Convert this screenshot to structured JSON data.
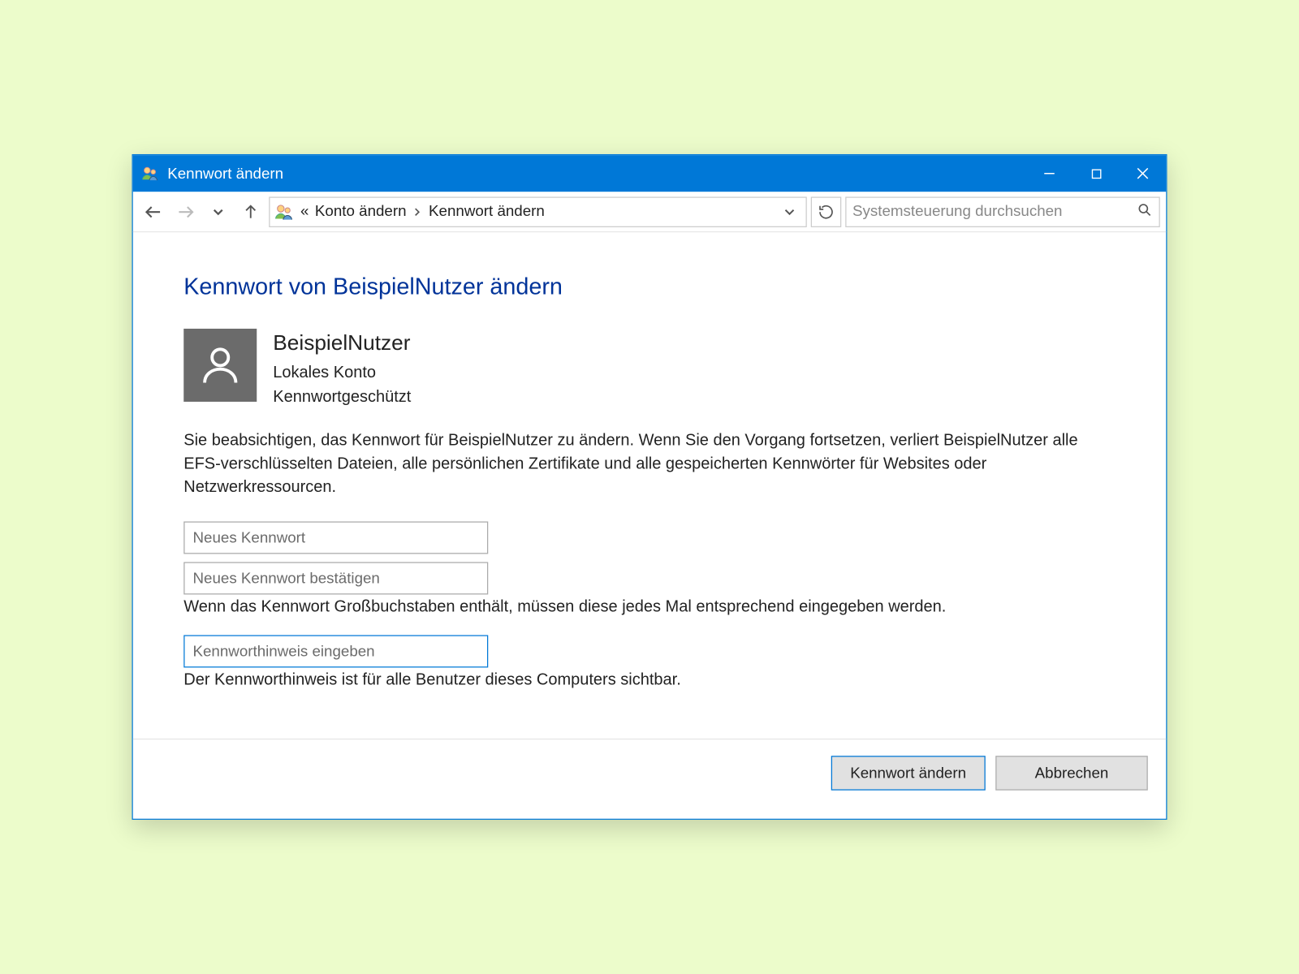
{
  "window": {
    "title": "Kennwort ändern"
  },
  "toolbar": {
    "breadcrumb_prefix": "«",
    "crumb1": "Konto ändern",
    "crumb2": "Kennwort ändern",
    "search_placeholder": "Systemsteuerung durchsuchen"
  },
  "page": {
    "heading": "Kennwort von BeispielNutzer ändern",
    "user": {
      "name": "BeispielNutzer",
      "type": "Lokales Konto",
      "status": "Kennwortgeschützt"
    },
    "warning": "Sie beabsichtigen, das Kennwort für BeispielNutzer zu ändern. Wenn Sie den Vorgang fortsetzen, verliert BeispielNutzer alle EFS-verschlüsselten Dateien, alle persönlichen Zertifikate und alle gespeicherten Kennwörter für Websites oder Netzwerkressourcen.",
    "fields": {
      "new_pw_placeholder": "Neues Kennwort",
      "confirm_pw_placeholder": "Neues Kennwort bestätigen",
      "caps_note": "Wenn das Kennwort Großbuchstaben enthält, müssen diese jedes Mal entsprechend eingegeben werden.",
      "hint_placeholder": "Kennworthinweis eingeben",
      "hint_note": "Der Kennworthinweis ist für alle Benutzer dieses Computers sichtbar."
    }
  },
  "buttons": {
    "primary": "Kennwort ändern",
    "cancel": "Abbrechen"
  }
}
